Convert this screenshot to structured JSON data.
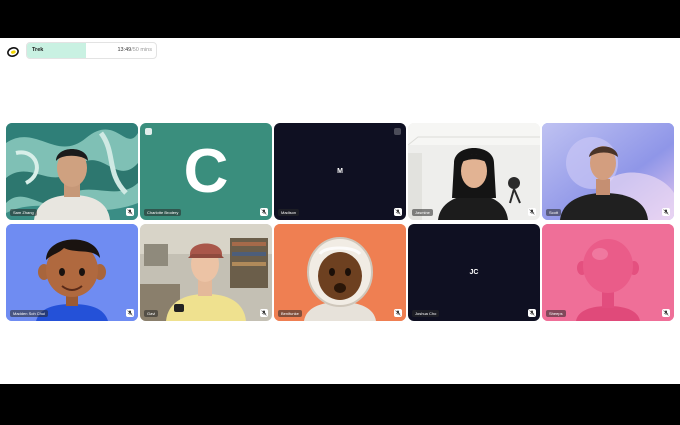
{
  "task": {
    "title": "Trek",
    "time": "13:49",
    "separator": "/",
    "total": "50 mins",
    "progress": 0.46
  },
  "colors": {
    "accent": "#c9f1e2",
    "active_outline": "#7fa7f5",
    "dark_tile": "#0f1022"
  },
  "participants": [
    {
      "name": "Sam Zhang",
      "kind": "video",
      "mic_icon": "mic-muted-icon"
    },
    {
      "name": "Charlotte Brodery",
      "kind": "letter",
      "letter": "C",
      "mic_icon": "mic-muted-icon"
    },
    {
      "name": "Madison",
      "kind": "initials",
      "initials": "M",
      "mic_icon": "mic-muted-icon"
    },
    {
      "name": "Jasmine",
      "kind": "video",
      "mic_icon": "mic-muted-icon"
    },
    {
      "name": "Scott",
      "kind": "video",
      "mic_icon": "mic-muted-icon"
    },
    {
      "name": "Madden Soh Chui",
      "kind": "avatar",
      "mic_icon": "mic-muted-icon"
    },
    {
      "name": "Gavi",
      "kind": "video",
      "mic_icon": "mic-muted-icon"
    },
    {
      "name": "Benifunke",
      "kind": "avatar",
      "mic_icon": "mic-muted-icon"
    },
    {
      "name": "Joshua Cho",
      "kind": "initials",
      "initials": "JC",
      "mic_icon": "mic-muted-icon"
    },
    {
      "name": "Sheeps",
      "kind": "avatar",
      "mic_icon": "mic-muted-icon"
    }
  ]
}
